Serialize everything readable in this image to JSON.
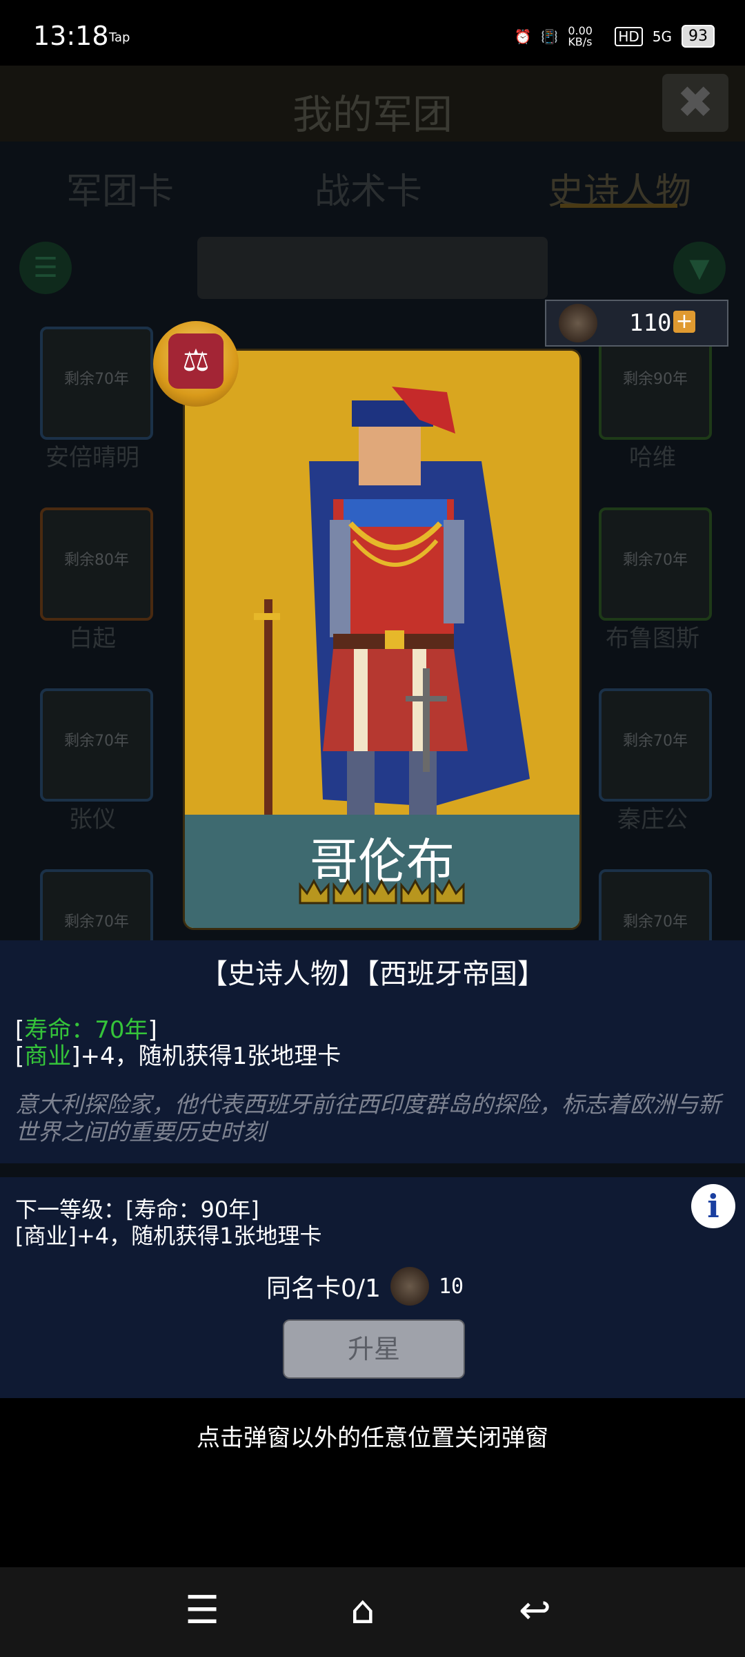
{
  "status_bar": {
    "time": "13:18",
    "app": "Tap",
    "net_speed": "0.00 KB/s",
    "hd": "HD",
    "network": "5G",
    "battery": "93"
  },
  "header": {
    "title": "我的军团",
    "close": "✖"
  },
  "tabs": [
    {
      "label": "军团卡"
    },
    {
      "label": "战术卡"
    },
    {
      "label": "史诗人物"
    }
  ],
  "grid": {
    "cards": [
      {
        "label": "剩余70年",
        "name": "安倍晴明"
      },
      {
        "label": "剩余90年",
        "name": "哈维"
      },
      {
        "label": "剩余80年",
        "name": "白起"
      },
      {
        "label": "剩余70年",
        "name": "布鲁图斯"
      },
      {
        "label": "剩余70年",
        "name": "张仪"
      },
      {
        "label": "剩余70年",
        "name": "秦庄公"
      },
      {
        "label": "剩余70年",
        "name": ""
      },
      {
        "label": "剩余70年",
        "name": ""
      }
    ]
  },
  "currency": {
    "value": "110",
    "plus": "+"
  },
  "card": {
    "name": "哥伦布",
    "stars": 5
  },
  "info": {
    "tags": "【史诗人物】【西班牙帝国】",
    "lifespan_open": "[",
    "lifespan": "寿命：70年",
    "lifespan_close": "]",
    "effect_open": "[",
    "effect_tag": "商业",
    "effect_rest": "]+4，随机获得1张地理卡",
    "description": "意大利探险家，他代表西班牙前往西印度群岛的探险，标志着欧洲与新世界之间的重要历史时刻"
  },
  "next": {
    "line1": "下一等级：[寿命：90年]",
    "line2": "[商业]+4，随机获得1张地理卡",
    "same_card": "同名卡0/1",
    "cost": "10",
    "upgrade": "升星"
  },
  "hint": "点击弹窗以外的任意位置关闭弹窗",
  "colors": {
    "card_bg": "#d9a61f",
    "panel_bg": "#0f1a33",
    "lifespan_green": "#35c43a"
  }
}
